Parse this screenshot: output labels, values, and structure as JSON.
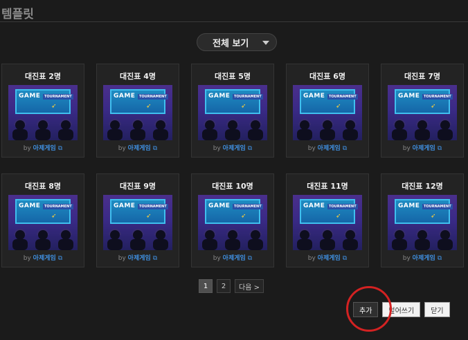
{
  "header": {
    "title": "템플릿"
  },
  "filter": {
    "label": "전체 보기"
  },
  "cards": [
    {
      "title": "대진표 2명",
      "by": "by",
      "author": "아제게임"
    },
    {
      "title": "대진표 4명",
      "by": "by",
      "author": "아제게임"
    },
    {
      "title": "대진표 5명",
      "by": "by",
      "author": "아제게임"
    },
    {
      "title": "대진표 6명",
      "by": "by",
      "author": "아제게임"
    },
    {
      "title": "대진표 7명",
      "by": "by",
      "author": "아제게임"
    },
    {
      "title": "대진표 8명",
      "by": "by",
      "author": "아제게임"
    },
    {
      "title": "대진표 9명",
      "by": "by",
      "author": "아제게임"
    },
    {
      "title": "대진표 10명",
      "by": "by",
      "author": "아제게임"
    },
    {
      "title": "대진표 11명",
      "by": "by",
      "author": "아제게임"
    },
    {
      "title": "대진표 12명",
      "by": "by",
      "author": "아제게임"
    }
  ],
  "thumbnail": {
    "game_text": "GAME",
    "tournament_text": "TOURNAMENT"
  },
  "pagination": {
    "pages": [
      "1",
      "2"
    ],
    "current": "1",
    "next": "다음 >"
  },
  "actions": {
    "add": "추가",
    "overwrite": "덮어쓰기",
    "close": "닫기"
  },
  "colors": {
    "accent_link": "#3f8fe0",
    "highlight": "#d32222"
  }
}
